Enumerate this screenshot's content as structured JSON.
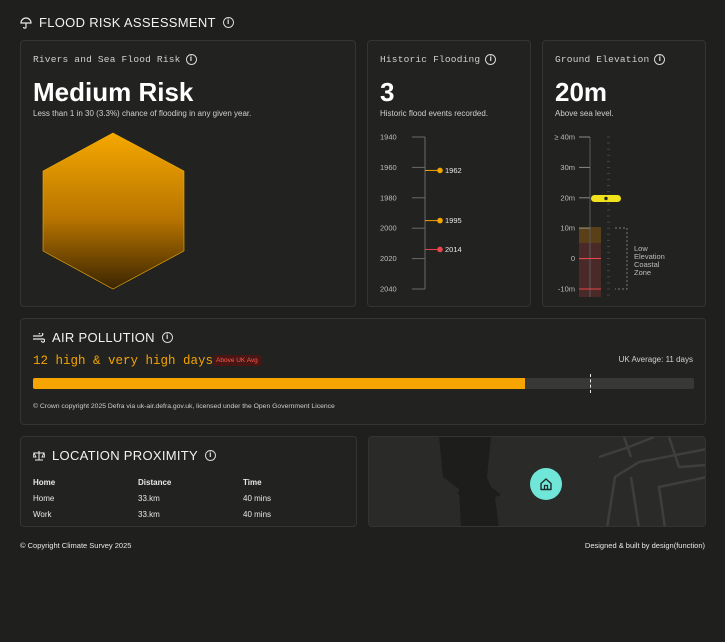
{
  "flood": {
    "section_title": "FLOOD RISK ASSESSMENT",
    "rivers": {
      "label": "Rivers and Sea Flood Risk",
      "value": "Medium Risk",
      "description": "Less than 1 in 30 (3.3%) chance of flooding in any given year."
    },
    "historic": {
      "label": "Historic Flooding",
      "value": "3",
      "description": "Historic flood events recorded.",
      "axis_years": [
        "1940",
        "1960",
        "1980",
        "2000",
        "2020",
        "2040"
      ],
      "events": [
        {
          "year": "1962",
          "color": "#f5a400"
        },
        {
          "year": "1995",
          "color": "#f5a400"
        },
        {
          "year": "2014",
          "color": "#e8464a"
        }
      ]
    },
    "elevation": {
      "label": "Ground Elevation",
      "value": "20m",
      "description": "Above sea level.",
      "ticks": [
        "≥ 40m",
        "30m",
        "20m",
        "10m",
        "0",
        "-10m"
      ],
      "zone_label": "Low Elevation Coastal Zone",
      "marker_color": "#f2e21c"
    }
  },
  "air": {
    "section_title": "AIR POLLUTION",
    "headline": "12 high & very high days",
    "badge": "Above UK Avg",
    "uk_average": "UK Average: 11 days",
    "fill_fraction": 0.745,
    "uk_marker_fraction": 0.843,
    "bar_color": "#f5a400",
    "credit": "© Crown copyright 2025 Defra via uk-air.defra.gov.uk, licensed under the Open Government Licence"
  },
  "proximity": {
    "section_title": "LOCATION PROXIMITY",
    "headers": [
      "Home",
      "Distance",
      "Time"
    ],
    "rows": [
      [
        "Home",
        "33.km",
        "40 mins"
      ],
      [
        "Work",
        "33.km",
        "40 mins"
      ]
    ],
    "map_pin_color": "#6fe6d8"
  },
  "footer": {
    "copyright": "© Copyright Climate Survey 2025",
    "credit": "Designed & built by design(function)"
  }
}
